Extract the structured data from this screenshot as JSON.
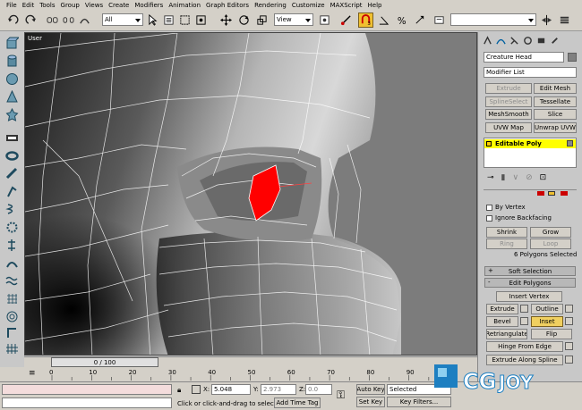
{
  "menu": [
    "File",
    "Edit",
    "Tools",
    "Group",
    "Views",
    "Create",
    "Modifiers",
    "Animation",
    "Graph Editors",
    "Rendering",
    "Customize",
    "MAXScript",
    "Help"
  ],
  "toolbar": {
    "selection_filter": "All",
    "coord_system": "View"
  },
  "viewport": {
    "label": "User"
  },
  "command_panel": {
    "object_name": "Creature Head",
    "modifier_list": "Modifier List",
    "buttons": [
      {
        "label": "Extrude",
        "disabled": true
      },
      {
        "label": "Edit Mesh",
        "disabled": false
      },
      {
        "label": "SplineSelect",
        "disabled": true
      },
      {
        "label": "Tessellate",
        "disabled": false
      },
      {
        "label": "MeshSmooth",
        "disabled": false
      },
      {
        "label": "Slice",
        "disabled": false
      },
      {
        "label": "UVW Map",
        "disabled": false
      },
      {
        "label": "Unwrap UVW",
        "disabled": false
      }
    ],
    "stack_item": "Editable Poly",
    "by_vertex": "By Vertex",
    "ignore_backfacing": "Ignore Backfacing",
    "shrink": "Shrink",
    "grow": "Grow",
    "ring": "Ring",
    "loop": "Loop",
    "selection_info": "6 Polygons Selected",
    "soft_selection": "Soft Selection",
    "edit_polygons": "Edit Polygons",
    "insert_vertex": "Insert Vertex",
    "extrude": "Extrude",
    "outline": "Outline",
    "bevel": "Bevel",
    "inset": "Inset",
    "retriangulate": "Retriangulate",
    "flip": "Flip",
    "hinge_from_edge": "Hinge From Edge",
    "extrude_along_spline": "Extrude Along Spline",
    "plus": "+",
    "minus": "-"
  },
  "timeline": {
    "frame_label": "0 / 100",
    "ticks": [
      "0",
      "10",
      "20",
      "30",
      "40",
      "50",
      "60",
      "70",
      "80",
      "90"
    ]
  },
  "status": {
    "prompt": "Click or click-and-drag to select ob",
    "add_time_tag": "Add Time Tag",
    "x_label": "X:",
    "x_value": "5.048",
    "y_label": "Y:",
    "y_value": "2.973",
    "z_label": "Z:",
    "z_value": "0.0",
    "auto_key": "Auto Key",
    "set_key": "Set Key",
    "key_mode": "Selected",
    "key_filters": "Key Filters..."
  },
  "watermark": {
    "brand": "CGJOY"
  },
  "colors": {
    "selection": "#ff0000",
    "active": "#f0c030",
    "stack_highlight": "#ffff00"
  }
}
